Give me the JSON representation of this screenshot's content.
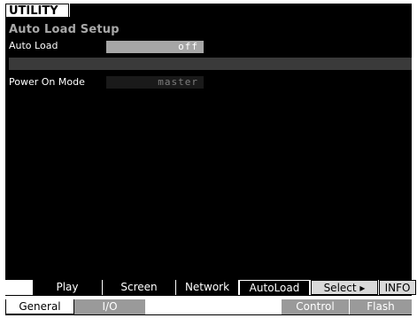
{
  "header": {
    "title": "UTILITY"
  },
  "section": {
    "title": "Auto Load Setup"
  },
  "params": {
    "auto_load": {
      "label": "Auto Load",
      "value": "off"
    },
    "power_on_mode": {
      "label": "Power On Mode",
      "value": "master"
    }
  },
  "upper_tabs": {
    "play": "Play",
    "screen": "Screen",
    "network": "Network",
    "autoload": "AutoLoad",
    "select": "Select ▸",
    "info": "INFO"
  },
  "lower_tabs": {
    "general": "General",
    "io": "I/O",
    "control": "Control",
    "flash": "Flash"
  },
  "colors": {
    "display_bg": "#000000",
    "value_active_bg": "#a6a6a6",
    "tab_inactive_bg": "#9a9a9a"
  }
}
